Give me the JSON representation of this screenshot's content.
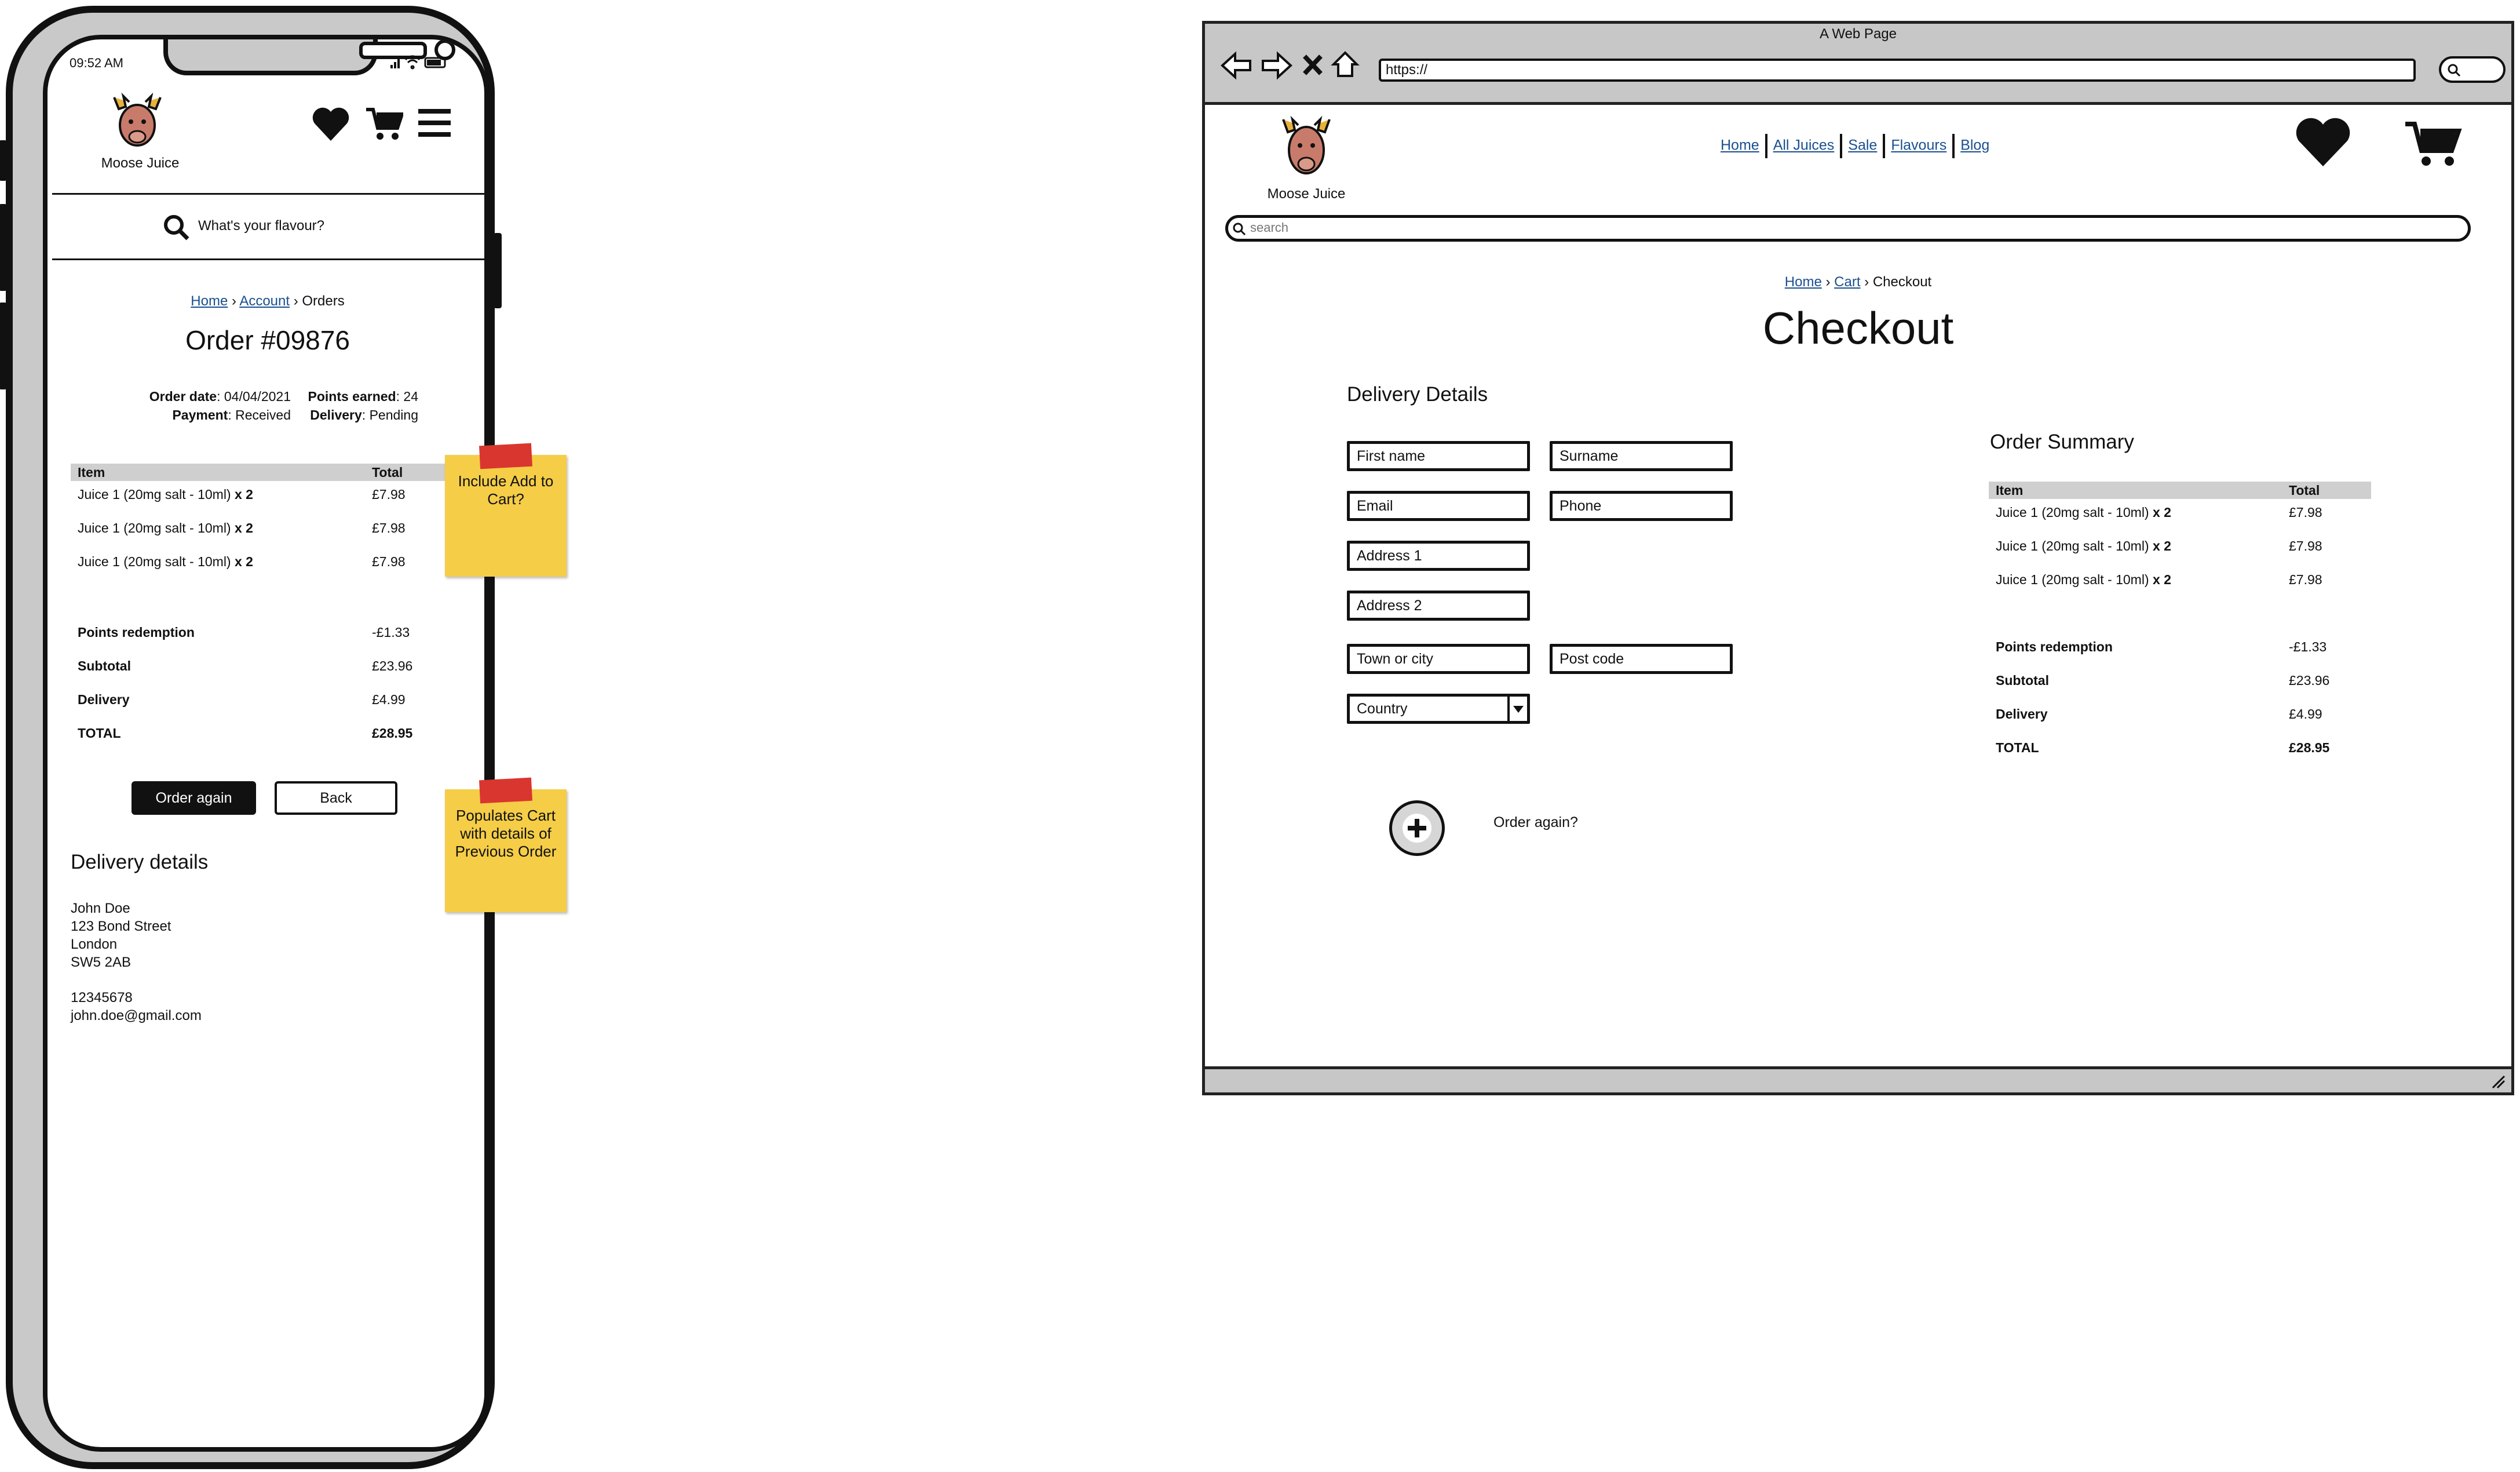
{
  "mobile": {
    "status_time": "09:52 AM",
    "brand": "Moose Juice",
    "search_placeholder": "What's your flavour?",
    "breadcrumb": {
      "home": "Home",
      "account": "Account",
      "current": "Orders"
    },
    "order_title": "Order #09876",
    "meta": {
      "order_date_label": "Order date",
      "order_date": "04/04/2021",
      "payment_label": "Payment",
      "payment": "Received",
      "points_label": "Points earned",
      "points": "24",
      "delivery_label": "Delivery",
      "delivery": "Pending"
    },
    "table": {
      "col_item": "Item",
      "col_total": "Total",
      "rows": [
        {
          "item": "Juice 1 (20mg salt - 10ml)",
          "qty": "x 2",
          "total": "£7.98"
        },
        {
          "item": "Juice 1 (20mg salt - 10ml)",
          "qty": "x 2",
          "total": "£7.98"
        },
        {
          "item": "Juice 1 (20mg salt - 10ml)",
          "qty": "x 2",
          "total": "£7.98"
        }
      ],
      "summary": [
        {
          "label": "Points redemption",
          "value": "-£1.33"
        },
        {
          "label": "Subtotal",
          "value": "£23.96"
        },
        {
          "label": "Delivery",
          "value": "£4.99"
        },
        {
          "label": "TOTAL",
          "value": "£28.95"
        }
      ]
    },
    "order_again_label": "Order again",
    "back_label": "Back",
    "delivery_heading": "Delivery details",
    "address": [
      "John Doe",
      "123 Bond Street",
      "London",
      "SW5 2AB"
    ],
    "phone": "12345678",
    "email": "john.doe@gmail.com"
  },
  "notes": {
    "note1": "Include Add to Cart?",
    "note2": "Populates Cart with details of Previous Order"
  },
  "desktop": {
    "window_title": "A Web Page",
    "url": "https://",
    "brand": "Moose Juice",
    "nav": [
      "Home",
      "All Juices",
      "Sale",
      "Flavours",
      "Blog"
    ],
    "search_placeholder": "search",
    "breadcrumb": {
      "home": "Home",
      "cart": "Cart",
      "current": "Checkout"
    },
    "page_title": "Checkout",
    "delivery_heading": "Delivery Details",
    "fields": {
      "first_name": "First name",
      "surname": "Surname",
      "email": "Email",
      "phone": "Phone",
      "address1": "Address 1",
      "address2": "Address 2",
      "town": "Town or city",
      "postcode": "Post code",
      "country": "Country"
    },
    "order_again_label": "Order again?",
    "summary_heading": "Order Summary",
    "table": {
      "col_item": "Item",
      "col_total": "Total",
      "rows": [
        {
          "item": "Juice 1 (20mg salt - 10ml)",
          "qty": "x 2",
          "total": "£7.98"
        },
        {
          "item": "Juice 1 (20mg salt - 10ml)",
          "qty": "x 2",
          "total": "£7.98"
        },
        {
          "item": "Juice 1 (20mg salt - 10ml)",
          "qty": "x 2",
          "total": "£7.98"
        }
      ],
      "summary": [
        {
          "label": "Points redemption",
          "value": "-£1.33"
        },
        {
          "label": "Subtotal",
          "value": "£23.96"
        },
        {
          "label": "Delivery",
          "value": "£4.99"
        },
        {
          "label": "TOTAL",
          "value": "£28.95"
        }
      ]
    }
  },
  "colors": {
    "link": "#1a4f8f",
    "sticky": "#f5cd47",
    "tape": "#d9362f",
    "frame_grey": "#c7c7c7"
  }
}
